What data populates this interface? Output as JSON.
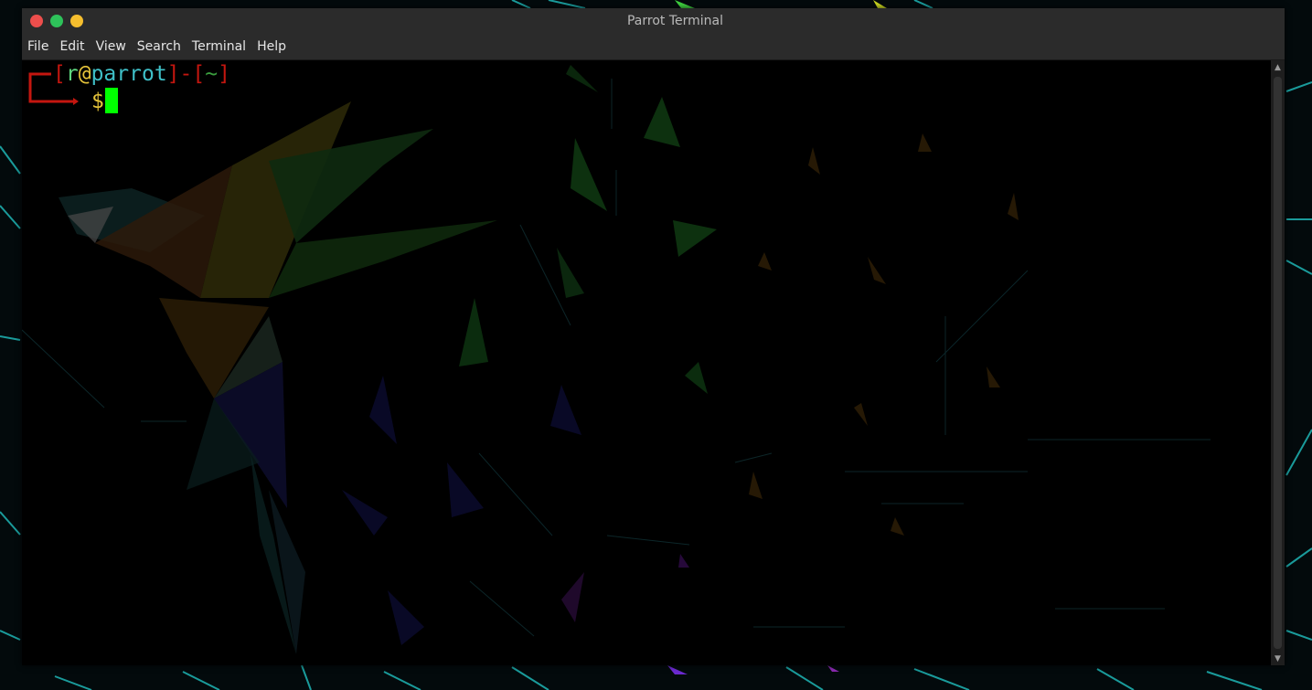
{
  "window": {
    "title": "Parrot Terminal"
  },
  "menu": [
    "File",
    "Edit",
    "View",
    "Search",
    "Terminal",
    "Help"
  ],
  "prompt": {
    "bracket_open": "[",
    "user": "r",
    "at": "@",
    "host": "parrot",
    "bracket_close": "]",
    "dash": "-",
    "dir": "~",
    "symbol": "$"
  },
  "colors": {
    "bracket": "#c4160f",
    "user": "#5fd77f",
    "at": "#e5c33a",
    "host": "#3fc0c8",
    "dir": "#3b9f3f",
    "symbol": "#e5c33a",
    "cursor": "#00ff00",
    "close_button": "#ed4e4c",
    "maximize_button": "#2ec25a",
    "minimize_button": "#f5be2e"
  },
  "icons": {
    "close": "close-icon",
    "maximize": "maximize-icon",
    "minimize": "minimize-icon",
    "scroll_up": "arrow-up-icon",
    "scroll_down": "arrow-down-icon"
  }
}
